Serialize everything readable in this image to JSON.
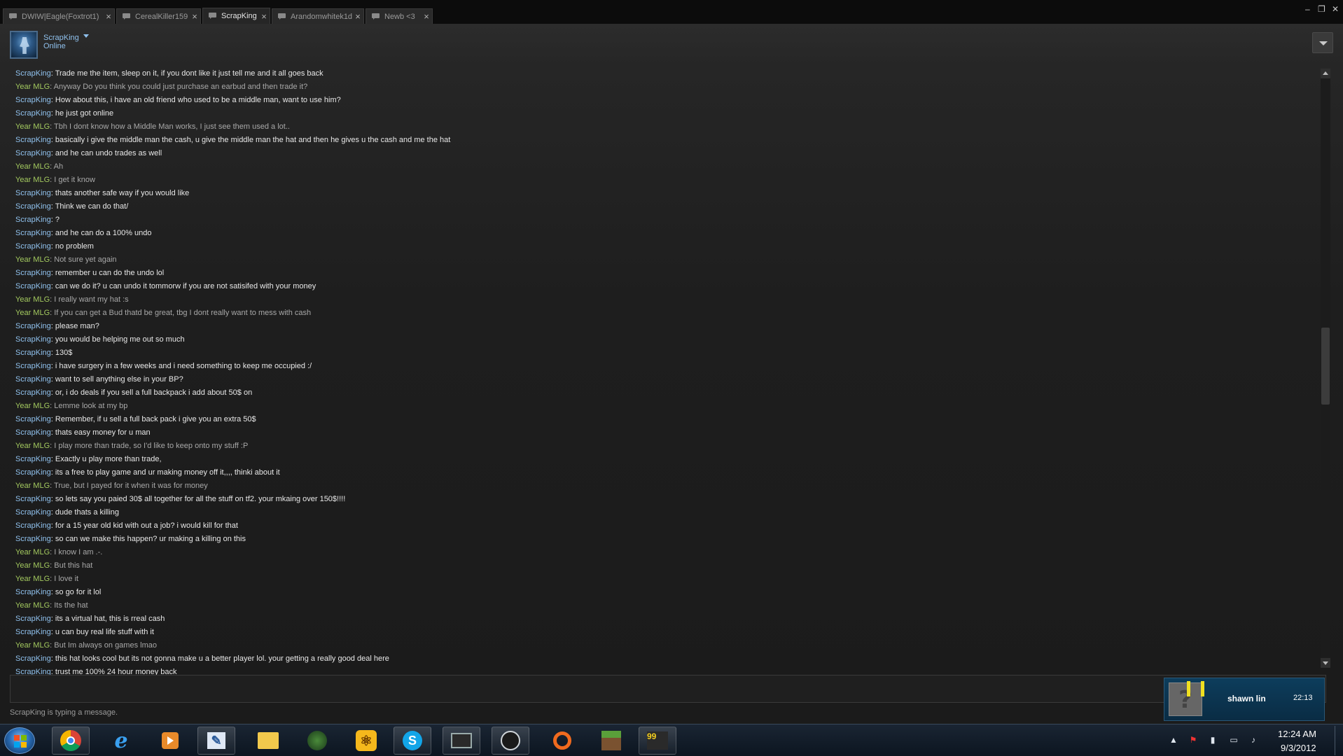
{
  "tabs": [
    {
      "label": "DWIW|Eagle(Foxtrot1)",
      "close": "×"
    },
    {
      "label": "CerealKiller159",
      "close": "×"
    },
    {
      "label": "ScrapKing",
      "close": "×",
      "active": true
    },
    {
      "label": "Arandomwhitek1d",
      "close": "×"
    },
    {
      "label": "Newb <3",
      "close": "×"
    }
  ],
  "window_controls": {
    "minimize": "–",
    "restore": "❐",
    "close": "✕"
  },
  "header": {
    "username": "ScrapKing",
    "status": "Online"
  },
  "messages": [
    {
      "from": "ScrapKing",
      "text": "Trade me the item, sleep on it, if you dont like it just tell me and it all goes back"
    },
    {
      "from": "Year MLG",
      "text": "Anyway Do you think you could just purchase an earbud and then trade it?"
    },
    {
      "from": "ScrapKing",
      "text": "How about this, i have an old friend who used to be a middle man, want to use him?"
    },
    {
      "from": "ScrapKing",
      "text": "he just got online"
    },
    {
      "from": "Year MLG",
      "text": "Tbh I dont know how a Middle Man works, I just see them used a lot.."
    },
    {
      "from": "ScrapKing",
      "text": "basically i give the middle man the cash, u give the middle man the hat and then he gives u the cash and me the hat"
    },
    {
      "from": "ScrapKing",
      "text": "and he can undo trades as well"
    },
    {
      "from": "Year MLG",
      "text": "Ah"
    },
    {
      "from": "Year MLG",
      "text": "I get it know"
    },
    {
      "from": "ScrapKing",
      "text": "thats another safe way if you would like"
    },
    {
      "from": "ScrapKing",
      "text": "Think we can do that/"
    },
    {
      "from": "ScrapKing",
      "text": "?"
    },
    {
      "from": "ScrapKing",
      "text": "and he can do a 100% undo"
    },
    {
      "from": "ScrapKing",
      "text": "no problem"
    },
    {
      "from": "Year MLG",
      "text": "Not sure yet again"
    },
    {
      "from": "ScrapKing",
      "text": "remember u can do the undo lol"
    },
    {
      "from": "ScrapKing",
      "text": "can we do it? u can undo it tommorw if you are not satisifed with your money"
    },
    {
      "from": "Year MLG",
      "text": "I really want my hat :s"
    },
    {
      "from": "Year MLG",
      "text": "If you can get a Bud thatd be great, tbg I dont really want to mess with cash"
    },
    {
      "from": "ScrapKing",
      "text": "please man?"
    },
    {
      "from": "ScrapKing",
      "text": "you would be helping me out so much"
    },
    {
      "from": "ScrapKing",
      "text": "130$"
    },
    {
      "from": "ScrapKing",
      "text": "i have surgery in a few weeks and i need something to keep me occupied :/"
    },
    {
      "from": "ScrapKing",
      "text": "want to sell anything else in your BP?"
    },
    {
      "from": "ScrapKing",
      "text": "or, i do deals if you sell a full backpack i add about 50$ on"
    },
    {
      "from": "Year MLG",
      "text": "Lemme look at my bp"
    },
    {
      "from": "ScrapKing",
      "text": "Remember, if u sell a full back pack i give you an extra 50$"
    },
    {
      "from": "ScrapKing",
      "text": "thats easy money for u man"
    },
    {
      "from": "Year MLG",
      "text": "I play more than trade, so I'd like to keep onto my stuff :P"
    },
    {
      "from": "ScrapKing",
      "text": "Exactly u play more than trade,"
    },
    {
      "from": "ScrapKing",
      "text": "its a free to play game and ur making money off it,,,, thinki about it"
    },
    {
      "from": "Year MLG",
      "text": "True, but I payed for it when it was for money"
    },
    {
      "from": "ScrapKing",
      "text": "so lets say you paied 30$ all together for all the stuff on tf2. your mkaing over 150$!!!!"
    },
    {
      "from": "ScrapKing",
      "text": "dude thats a killing"
    },
    {
      "from": "ScrapKing",
      "text": "for a 15 year old kid with out a job? i would kill for that"
    },
    {
      "from": "ScrapKing",
      "text": "so can we make this happen? ur making a killing on this"
    },
    {
      "from": "Year MLG",
      "text": "I know I am .-."
    },
    {
      "from": "Year MLG",
      "text": "But this hat"
    },
    {
      "from": "Year MLG",
      "text": "I love it"
    },
    {
      "from": "ScrapKing",
      "text": "so go for it lol"
    },
    {
      "from": "Year MLG",
      "text": "Its the hat"
    },
    {
      "from": "ScrapKing",
      "text": "its a virtual hat, this is rreal cash"
    },
    {
      "from": "ScrapKing",
      "text": "u can buy real life stuff with it"
    },
    {
      "from": "Year MLG",
      "text": "But Im always on games lmao"
    },
    {
      "from": "ScrapKing",
      "text": "this hat looks cool but its not gonna make u a better player lol. your getting a really good deal here"
    },
    {
      "from": "ScrapKing",
      "text": "trust me 100% 24 hour money back"
    }
  ],
  "typing_status": "ScrapKing is typing a message.",
  "notification": {
    "avatar_glyph": "?",
    "name": "shawn lin",
    "time": "22:13"
  },
  "taskbar": {
    "apps": [
      {
        "name": "chrome-icon"
      },
      {
        "name": "internet-explorer-icon"
      },
      {
        "name": "media-player-icon"
      },
      {
        "name": "notepad-icon"
      },
      {
        "name": "file-explorer-icon"
      },
      {
        "name": "media-icon"
      },
      {
        "name": "atom-app-icon"
      },
      {
        "name": "skype-icon",
        "glyph": "S"
      },
      {
        "name": "monitor-app-icon"
      },
      {
        "name": "steam-icon"
      },
      {
        "name": "origin-icon"
      },
      {
        "name": "minecraft-icon"
      },
      {
        "name": "game-99-icon",
        "glyph": "99"
      }
    ],
    "clock_time": "12:24 AM",
    "clock_date": "9/3/2012"
  },
  "colors": {
    "scrapking": "#8fc0ec",
    "year_mlg": "#a3c95f",
    "notification_bg": "#0d3d5c"
  }
}
